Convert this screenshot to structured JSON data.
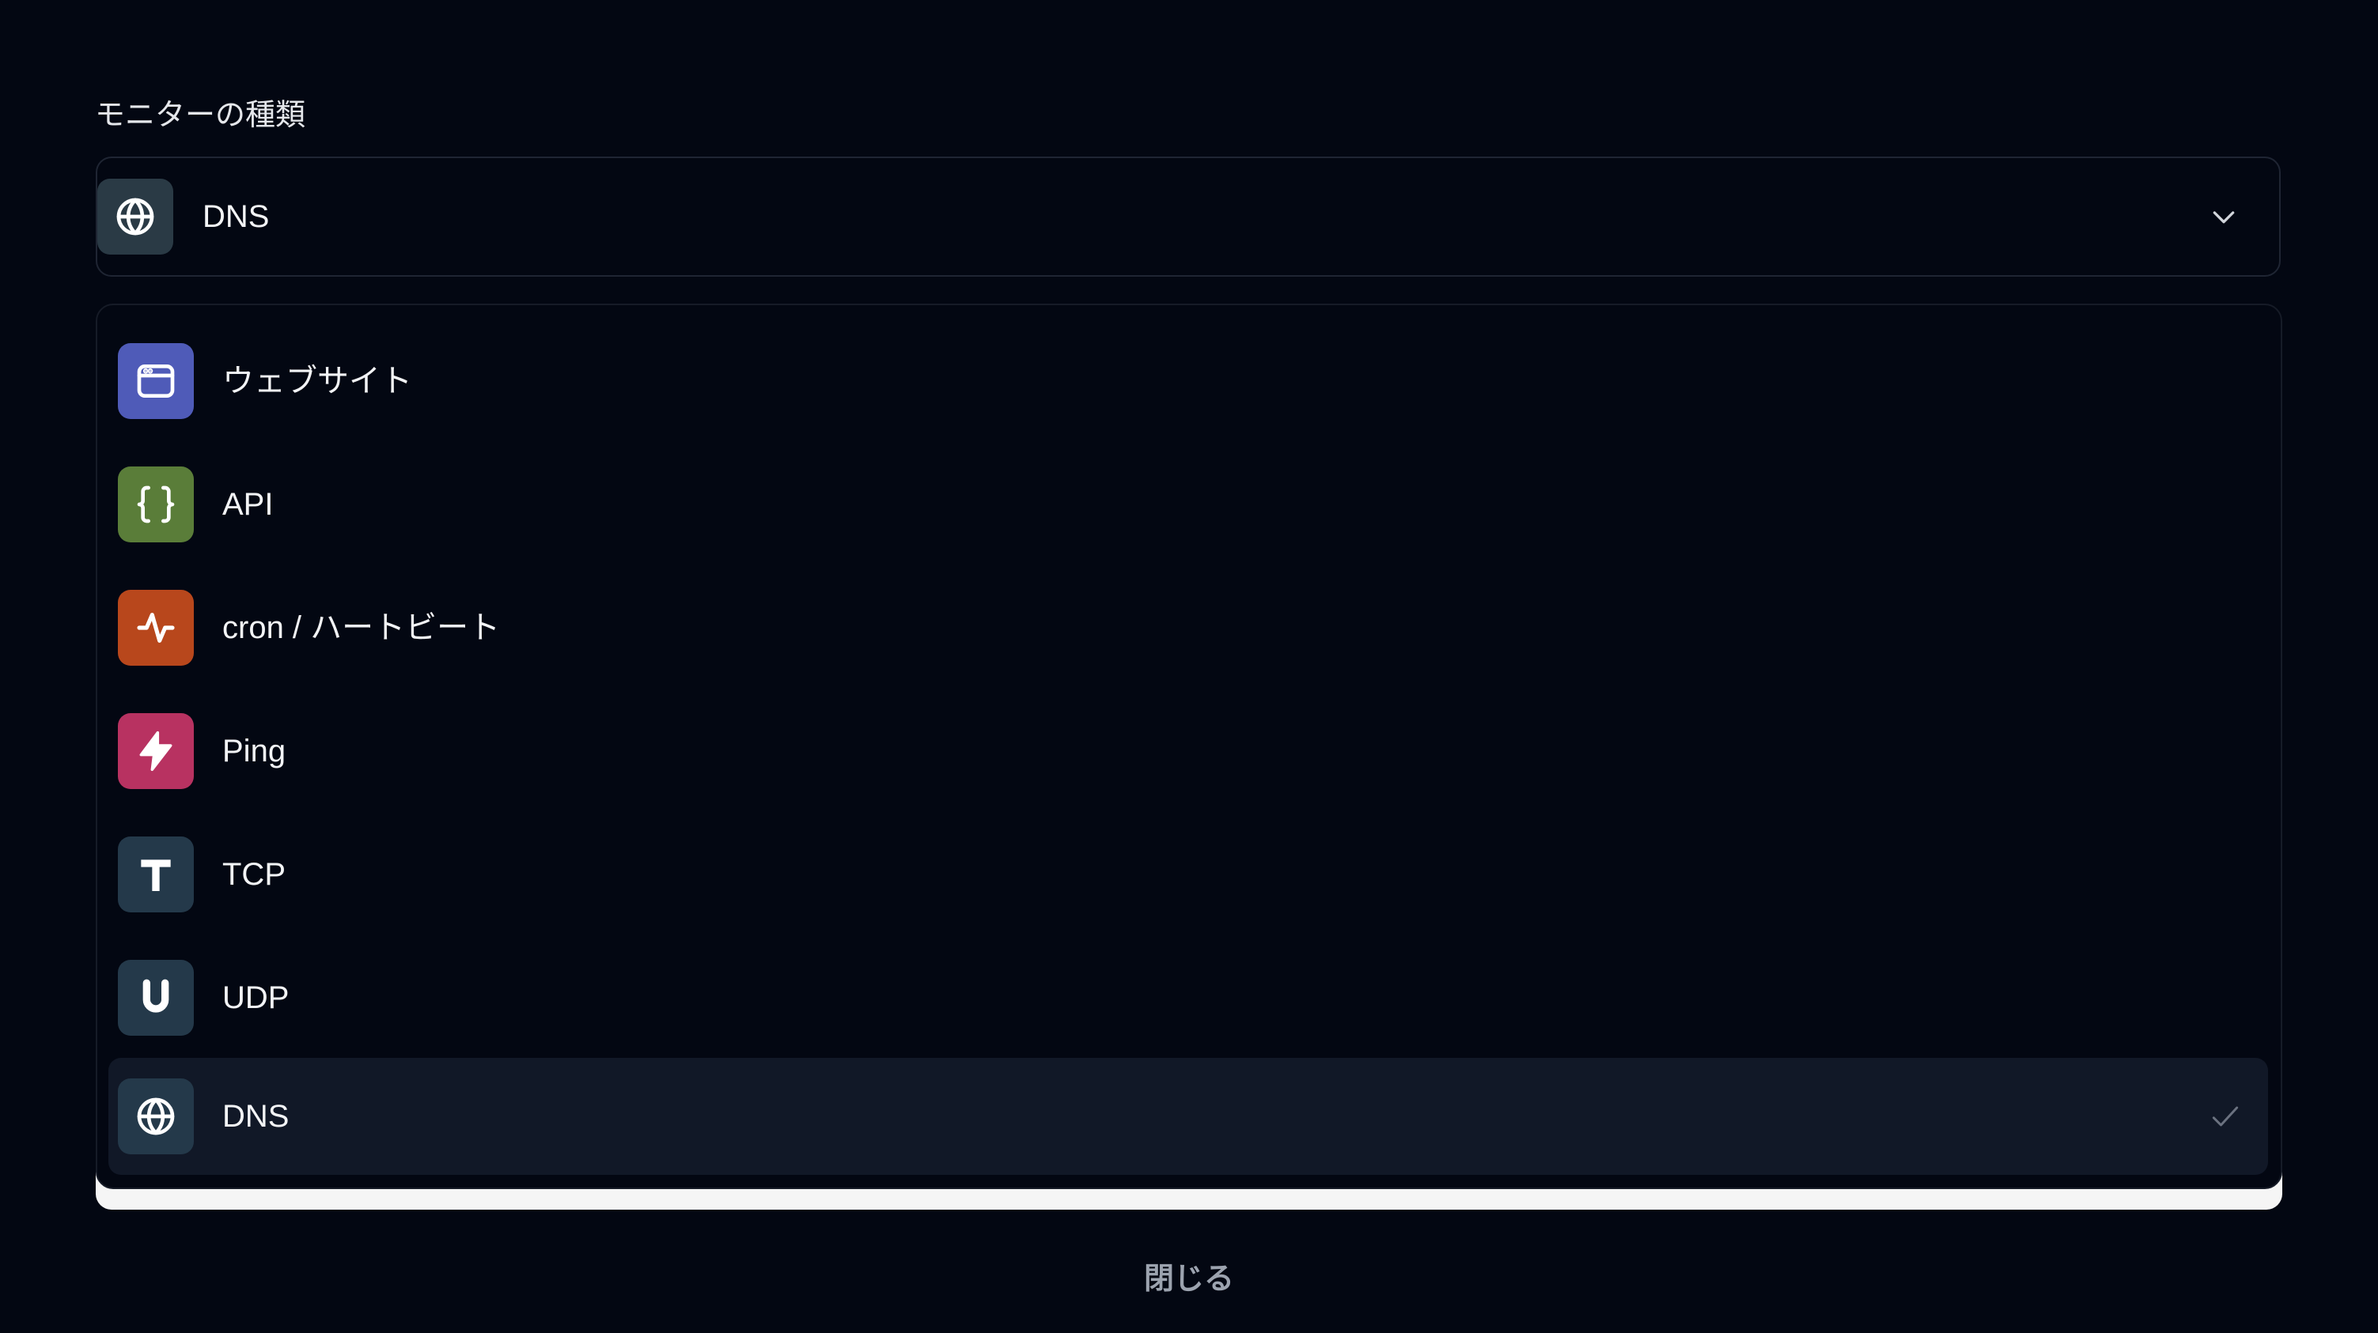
{
  "field_label": "モニターの種類",
  "select": {
    "value": "DNS",
    "icon": "globe-icon",
    "icon_color": "#2a3a45"
  },
  "options": [
    {
      "label": "ウェブサイト",
      "icon": "browser-window-icon",
      "color": "#4f5bb8",
      "selected": false
    },
    {
      "label": "API",
      "icon": "curly-braces-icon",
      "color": "#5a7d39",
      "selected": false
    },
    {
      "label": "cron / ハートビート",
      "icon": "activity-icon",
      "color": "#b8471c",
      "selected": false
    },
    {
      "label": "Ping",
      "icon": "lightning-icon",
      "color": "#b83261",
      "selected": false
    },
    {
      "label": "TCP",
      "icon": "letter-t-icon",
      "color": "#24394a",
      "selected": false
    },
    {
      "label": "UDP",
      "icon": "letter-u-icon",
      "color": "#24394a",
      "selected": false
    },
    {
      "label": "DNS",
      "icon": "globe-icon",
      "color": "#24394a",
      "selected": true
    }
  ],
  "close_label": "閉じる",
  "colors": {
    "background": "#030712",
    "selected_row": "#111827",
    "check": "#6b7280"
  }
}
